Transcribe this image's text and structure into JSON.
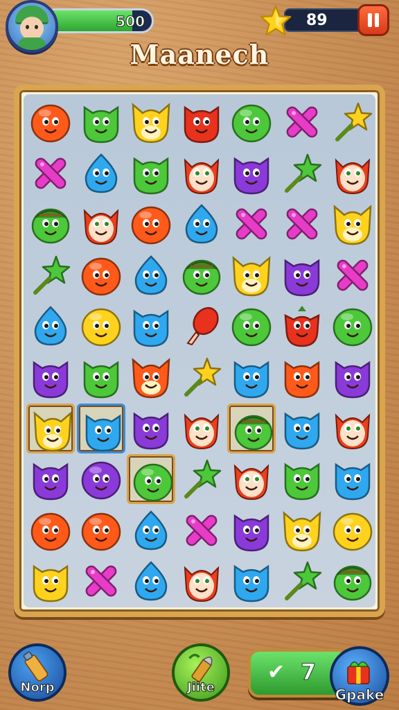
{
  "header": {
    "score": "500",
    "score_progress": 0.82,
    "moves": "89",
    "title": "Maanech"
  },
  "board": {
    "rows": [
      [
        "orange-blob",
        "green-cat",
        "yellow-fox",
        "red-cat",
        "green-blob",
        "pink-cross",
        "yellow-star"
      ],
      [
        "pink-cross",
        "blue-drop",
        "green-cat",
        "redhair-face",
        "purple-cat",
        "green-star",
        "redhair-face"
      ],
      [
        "green-turtle",
        "redhair-face",
        "orange-blob",
        "blue-drop",
        "pink-cross",
        "pink-cross",
        "yellow-fox"
      ],
      [
        "green-star",
        "orange-blob",
        "blue-drop",
        "green-turtle",
        "yellow-fox",
        "purple-cat",
        "pink-cross"
      ],
      [
        "blue-drop",
        "yellow-blob",
        "blue-cat",
        "red-balloon",
        "green-blob",
        "red-tomato",
        "green-blob"
      ],
      [
        "purple-cat",
        "green-cat",
        "orange-fox",
        "yellow-star",
        "blue-cat",
        "orange-cat",
        "purple-cat"
      ],
      [
        "yellow-fox",
        "blue-cat",
        "purple-cat",
        "redhair-face",
        "green-turtle",
        "blue-cat",
        "redhair-face"
      ],
      [
        "purple-cat",
        "purple-blob",
        "green-blob",
        "green-star",
        "redhair-face",
        "green-cat",
        "blue-cat"
      ],
      [
        "orange-blob",
        "orange-blob",
        "blue-drop",
        "pink-cross",
        "purple-cat",
        "yellow-fox",
        "yellow-blob"
      ],
      [
        "yellow-cat",
        "pink-cross",
        "blue-drop",
        "redhair-face",
        "blue-cat",
        "green-star",
        "green-turtle"
      ]
    ],
    "selected": [
      [
        6,
        0
      ],
      [
        6,
        1
      ],
      [
        6,
        4
      ],
      [
        7,
        2
      ]
    ]
  },
  "footer": {
    "boost1_label": "Norp",
    "boost2_label": "Jiite",
    "check_count": "7",
    "shop_label": "Gpake"
  },
  "colors": {
    "orange": "#ff5a1a",
    "green": "#4cc83a",
    "yellow": "#ffd21e",
    "red": "#e8321e",
    "pink": "#e83cc8",
    "blue": "#2fa8f0",
    "purple": "#8a3ad8"
  }
}
